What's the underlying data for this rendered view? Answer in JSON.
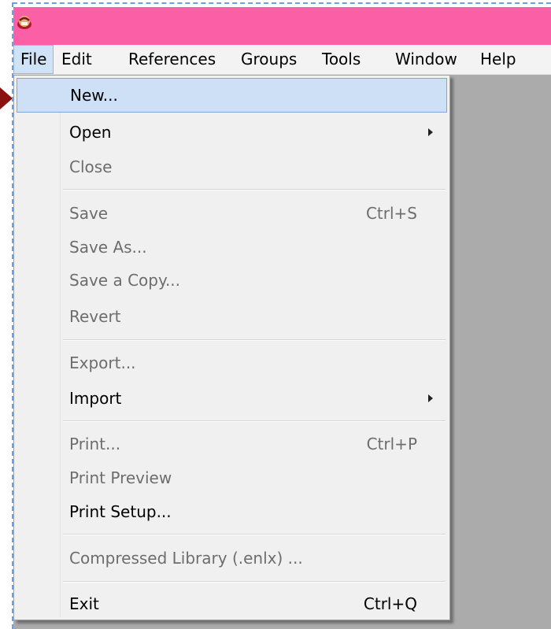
{
  "app": {
    "icon": "endnote-app-icon",
    "title_bar_color": "#fb5fa6"
  },
  "menubar": {
    "items": [
      {
        "label": "File"
      },
      {
        "label": "Edit"
      },
      {
        "label": "References"
      },
      {
        "label": "Groups"
      },
      {
        "label": "Tools"
      },
      {
        "label": "Window"
      },
      {
        "label": "Help"
      }
    ]
  },
  "file_menu": {
    "items": [
      {
        "label": "New...",
        "shortcut": "",
        "enabled": true,
        "highlighted": true,
        "submenu": false
      },
      {
        "label": "Open",
        "shortcut": "",
        "enabled": true,
        "highlighted": false,
        "submenu": true
      },
      {
        "label": "Close",
        "shortcut": "",
        "enabled": false,
        "highlighted": false,
        "submenu": false
      },
      {
        "label": "Save",
        "shortcut": "Ctrl+S",
        "enabled": false,
        "highlighted": false,
        "submenu": false
      },
      {
        "label": "Save As...",
        "shortcut": "",
        "enabled": false,
        "highlighted": false,
        "submenu": false
      },
      {
        "label": "Save a Copy...",
        "shortcut": "",
        "enabled": false,
        "highlighted": false,
        "submenu": false
      },
      {
        "label": "Revert",
        "shortcut": "",
        "enabled": false,
        "highlighted": false,
        "submenu": false
      },
      {
        "label": "Export...",
        "shortcut": "",
        "enabled": false,
        "highlighted": false,
        "submenu": false
      },
      {
        "label": "Import",
        "shortcut": "",
        "enabled": true,
        "highlighted": false,
        "submenu": true
      },
      {
        "label": "Print...",
        "shortcut": "Ctrl+P",
        "enabled": false,
        "highlighted": false,
        "submenu": false
      },
      {
        "label": "Print Preview",
        "shortcut": "",
        "enabled": false,
        "highlighted": false,
        "submenu": false
      },
      {
        "label": "Print Setup...",
        "shortcut": "",
        "enabled": true,
        "highlighted": false,
        "submenu": false
      },
      {
        "label": "Compressed Library (.enlx) ...",
        "shortcut": "",
        "enabled": false,
        "highlighted": false,
        "submenu": false
      },
      {
        "label": "Exit",
        "shortcut": "Ctrl+Q",
        "enabled": true,
        "highlighted": false,
        "submenu": false
      }
    ]
  },
  "colors": {
    "menu_highlight": "#cde0f5",
    "disabled_text": "#6d6d6d",
    "workspace": "#ababab",
    "pointer_arrow": "#8b1010"
  }
}
